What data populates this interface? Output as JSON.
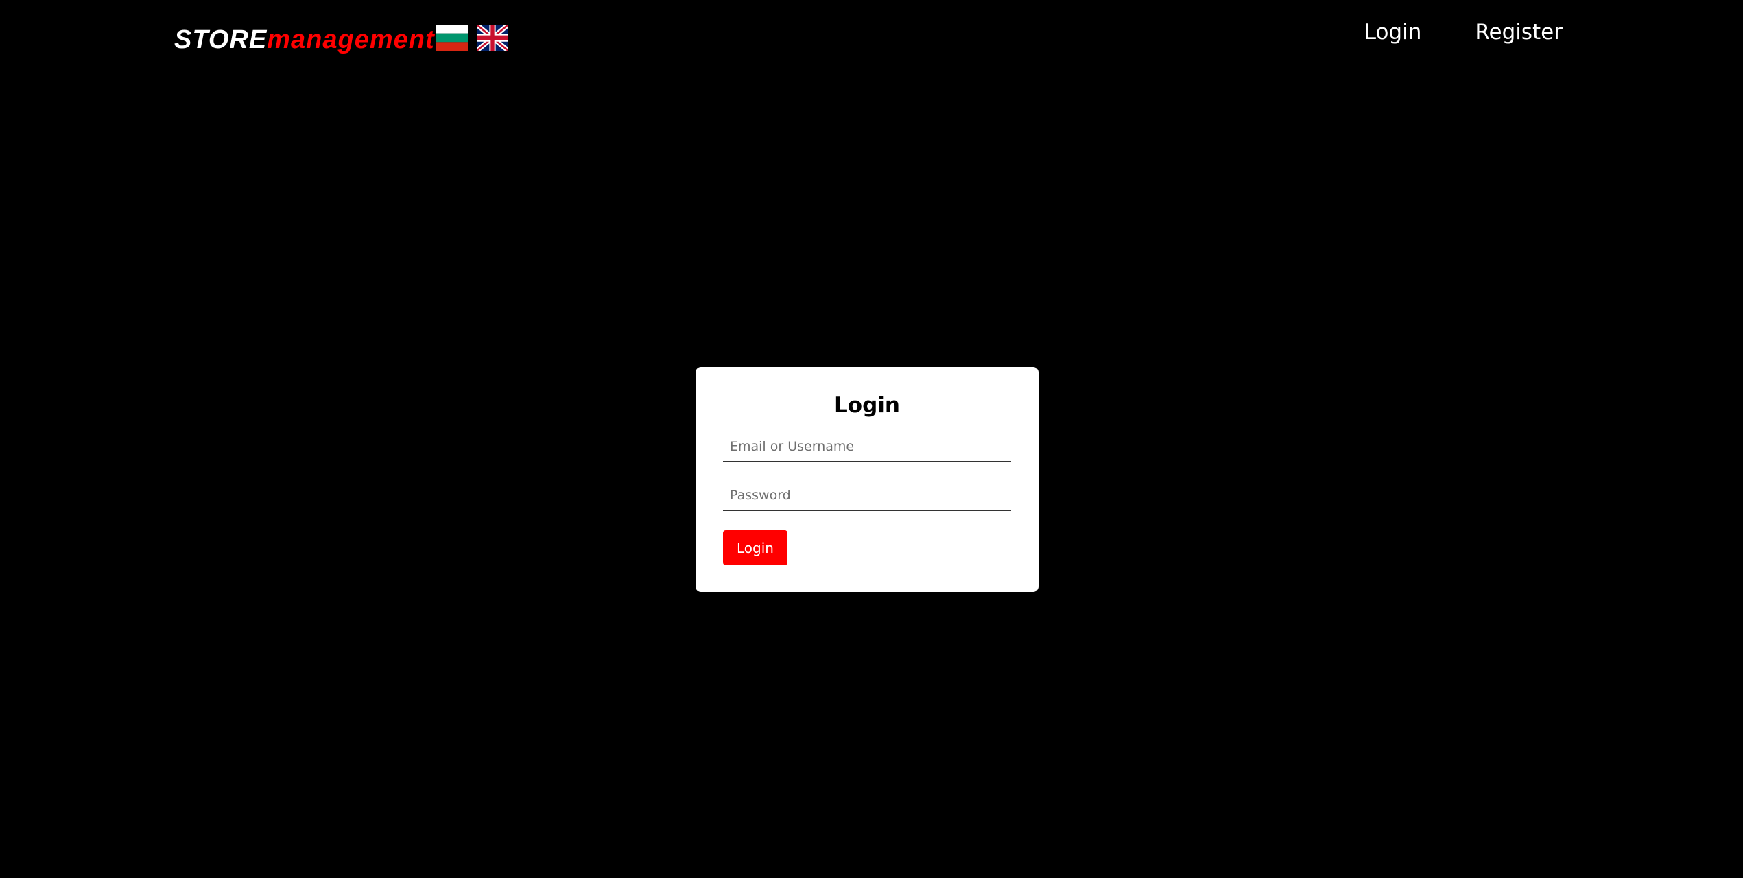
{
  "header": {
    "logo": {
      "part1": "STORE",
      "part2": "management",
      "part1_color": "#ffffff",
      "part2_color": "#ff0000"
    },
    "languages": [
      {
        "code": "bg",
        "icon": "bulgaria-flag-icon"
      },
      {
        "code": "en",
        "icon": "uk-flag-icon"
      }
    ],
    "nav": {
      "login": "Login",
      "register": "Register"
    }
  },
  "login_form": {
    "title": "Login",
    "email_placeholder": "Email or Username",
    "email_value": "",
    "password_placeholder": "Password",
    "password_value": "",
    "submit_label": "Login",
    "submit_color": "#ff0000"
  },
  "colors": {
    "background": "#000000",
    "card": "#ffffff",
    "accent": "#ff0000"
  }
}
